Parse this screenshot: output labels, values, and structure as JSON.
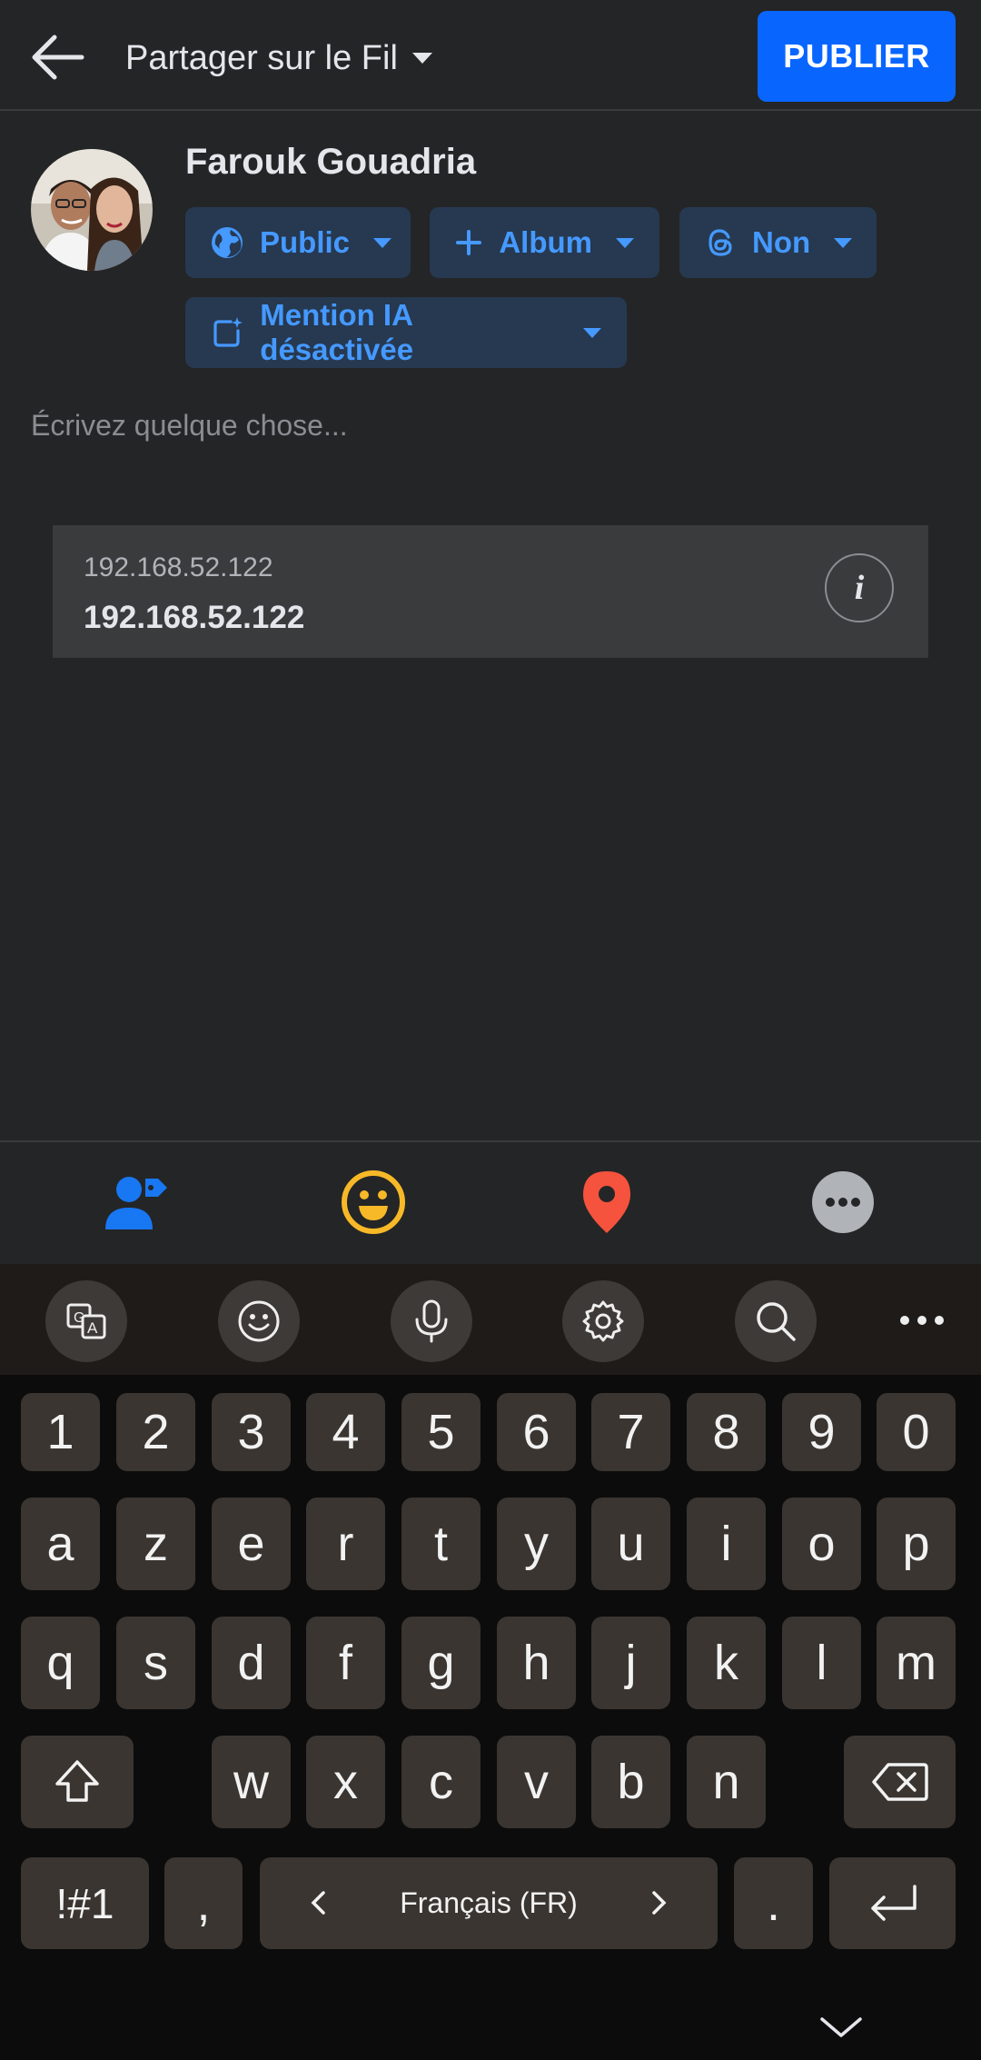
{
  "header": {
    "share_target": "Partager sur le Fil",
    "publish_label": "PUBLIER"
  },
  "composer": {
    "user_name": "Farouk Gouadria",
    "chips": [
      {
        "label": "Public",
        "icon": "globe-icon"
      },
      {
        "label": "Album",
        "icon": "plus-icon"
      },
      {
        "label": "Non",
        "icon": "threads-icon"
      },
      {
        "label": "Mention IA désactivée",
        "icon": "ai-label-icon"
      }
    ],
    "placeholder": "Écrivez quelque chose...",
    "link_preview": {
      "domain": "192.168.52.122",
      "title": "192.168.52.122",
      "info_label": "i"
    }
  },
  "action_bar": {
    "icons": [
      "tag-people-icon",
      "feeling-icon",
      "location-icon",
      "more-icon"
    ],
    "colors": {
      "tag": "#1877f2",
      "feeling": "#f7b928",
      "location": "#f5533d",
      "more": "#b0b3b8"
    }
  },
  "keyboard": {
    "toolbar": [
      "translate-icon",
      "emoji-icon",
      "mic-icon",
      "settings-icon",
      "search-icon",
      "more-icon"
    ],
    "row_numbers": [
      "1",
      "2",
      "3",
      "4",
      "5",
      "6",
      "7",
      "8",
      "9",
      "0"
    ],
    "row1": [
      "a",
      "z",
      "e",
      "r",
      "t",
      "y",
      "u",
      "i",
      "o",
      "p"
    ],
    "row2": [
      "q",
      "s",
      "d",
      "f",
      "g",
      "h",
      "j",
      "k",
      "l",
      "m"
    ],
    "row3": [
      "w",
      "x",
      "c",
      "v",
      "b",
      "n"
    ],
    "symbols_label": "!#1",
    "comma": ",",
    "space_label": "Français (FR)",
    "period": "."
  },
  "colors": {
    "background": "#242526",
    "accent": "#0866ff",
    "chip_bg": "#263951",
    "chip_text": "#4599ff"
  }
}
